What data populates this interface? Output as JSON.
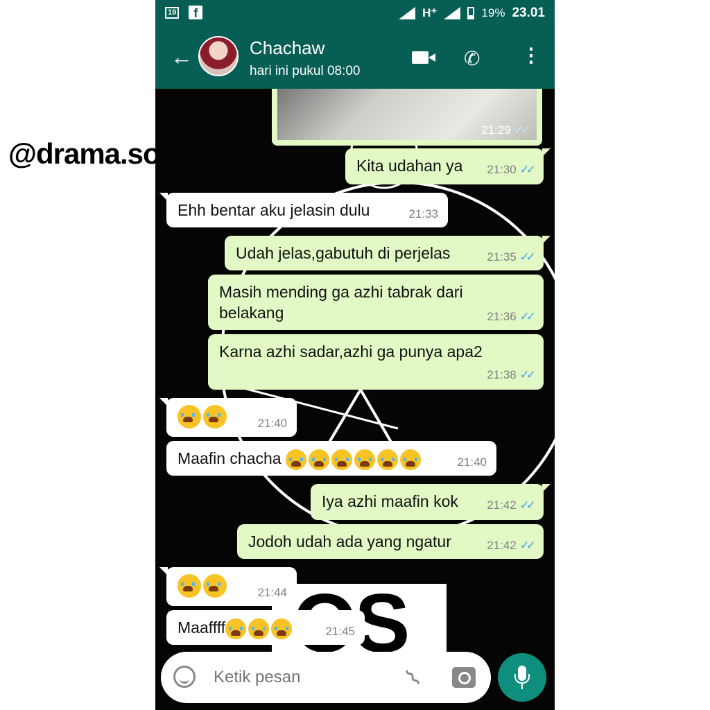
{
  "status_bar": {
    "sim_badge": "19",
    "network": "H⁺",
    "battery": "19%",
    "time": "23.01"
  },
  "header": {
    "contact_name": "Chachaw",
    "last_seen": "hari ini pukul 08:00"
  },
  "image_message": {
    "time": "21:29",
    "ticks": "✓✓"
  },
  "messages": [
    {
      "dir": "out",
      "text": "Kita udahan ya",
      "time": "21:30",
      "ticks": "✓✓"
    },
    {
      "dir": "in",
      "text": "Ehh bentar aku jelasin dulu",
      "time": "21:33"
    },
    {
      "dir": "out",
      "text": "Udah jelas,gabutuh di perjelas",
      "time": "21:35",
      "ticks": "✓✓"
    },
    {
      "dir": "out",
      "text": "Masih mending ga azhi tabrak dari belakang",
      "time": "21:36",
      "ticks": "✓✓"
    },
    {
      "dir": "out",
      "text": "Karna azhi sadar,azhi ga punya apa2",
      "time": "21:38",
      "ticks": "✓✓"
    },
    {
      "dir": "in",
      "text": "",
      "emoji_count": 2,
      "emoji": "loudly-crying-face",
      "time": "21:40"
    },
    {
      "dir": "in",
      "text": "Maafin chacha",
      "emoji_count": 6,
      "emoji": "loudly-crying-face",
      "time": "21:40"
    },
    {
      "dir": "out",
      "text": "Iya azhi maafin kok",
      "time": "21:42",
      "ticks": "✓✓"
    },
    {
      "dir": "out",
      "text": "Jodoh udah ada yang ngatur",
      "time": "21:42",
      "ticks": "✓✓"
    },
    {
      "dir": "in",
      "text": "",
      "emoji_count": 2,
      "emoji": "loudly-crying-face",
      "time": "21:44"
    },
    {
      "dir": "in",
      "text": "Maaffff",
      "emoji_count": 3,
      "emoji": "loudly-crying-face",
      "time": "21:45"
    }
  ],
  "background_text": "OS",
  "input_bar": {
    "placeholder": "Ketik pesan"
  },
  "watermark": "@drama.sosialmedia",
  "colors": {
    "header": "#075e54",
    "outgoing_bubble": "#e2f9c5",
    "incoming_bubble": "#ffffff",
    "mic_button": "#0e8f7d",
    "read_ticks": "#4aa9e0"
  }
}
